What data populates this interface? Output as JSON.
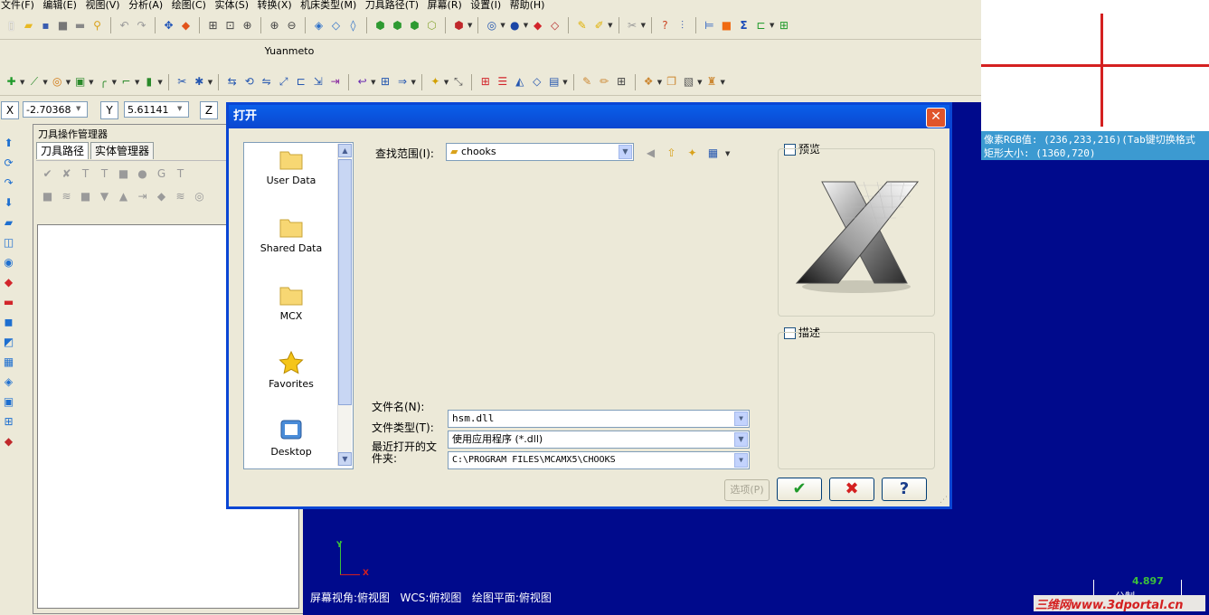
{
  "menu": [
    "文件(F)",
    "编辑(E)",
    "视图(V)",
    "分析(A)",
    "绘图(C)",
    "实体(S)",
    "转换(X)",
    "机床类型(M)",
    "刀具路径(T)",
    "屏幕(R)",
    "设置(I)",
    "帮助(H)"
  ],
  "toolbar_title": "Yuanmeto",
  "coords": {
    "x_label": "X",
    "x_value": "-2.70368",
    "y_label": "Y",
    "y_value": "5.61141",
    "z_label": "Z"
  },
  "ops_panel": {
    "title": "刀具操作管理器",
    "tabs": [
      "刀具路径",
      "实体管理器"
    ]
  },
  "pixel_info": {
    "line1": "像素RGB值: (236,233,216)(Tab键切换格式",
    "line2": "矩形大小: (1360,720)"
  },
  "graphics": {
    "axis_y": "Y",
    "axis_x": "X",
    "status": "屏幕视角:俯视图   WCS:俯视图   绘图平面:俯视图",
    "scale_value": "4.897",
    "scale_unit": "公制",
    "watermark": "三维网www.3dportal.cn"
  },
  "dialog": {
    "title": "打开",
    "lookin_label": "查找范围(I):",
    "lookin_value": "chooks",
    "places": [
      "User Data",
      "Shared Data",
      "MCX",
      "Favorites",
      "Desktop"
    ],
    "preview_label": "预览",
    "desc_label": "描述",
    "filename_label": "文件名(N):",
    "filename_value": "hsm.dll",
    "filetype_label": "文件类型(T):",
    "filetype_value": "使用应用程序 (*.dll)",
    "recent_label_1": "最近打开的文",
    "recent_label_2": "件夹:",
    "recent_value": "C:\\PROGRAM FILES\\MCAMX5\\CHOOKS",
    "options_label": "选项(P)",
    "ok_icon": "✔",
    "cancel_icon": "✖",
    "help_icon": "?"
  },
  "colors": {
    "graphics_bg": "#000a8c",
    "title_bar": "#0a5fea",
    "crosshair": "#d42020",
    "info_bg": "#3c9ad1"
  }
}
